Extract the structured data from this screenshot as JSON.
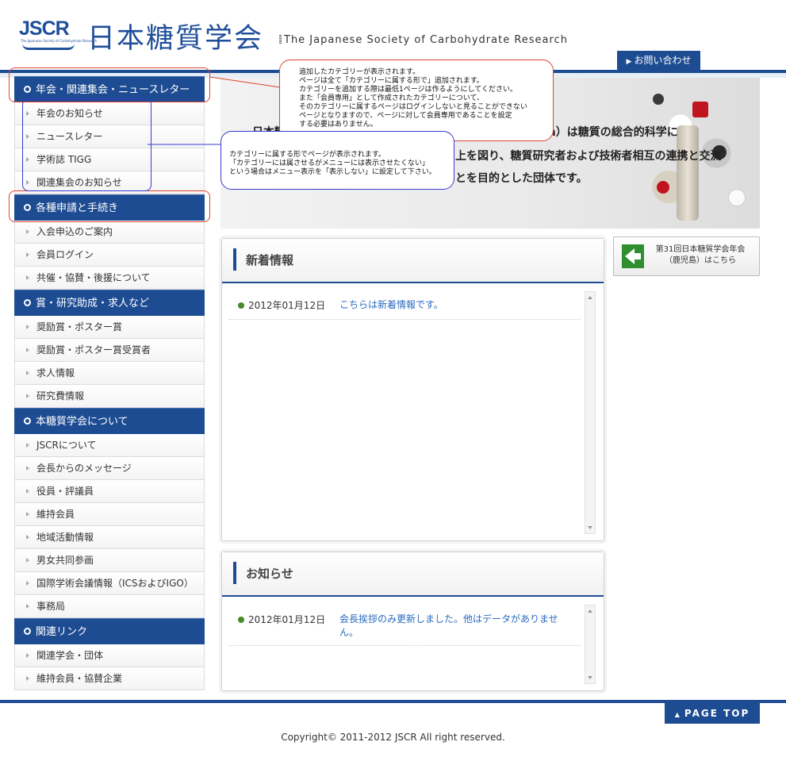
{
  "header": {
    "logo_text": "JSCR",
    "logo_subtext": "The Japanese Society of Carbohydrate Research",
    "title_jp": "日本糖質学会",
    "title_en": "The Japanese Society of Carbohydrate Research",
    "contact_label": "お問い合わせ"
  },
  "sidebar": {
    "groups": [
      {
        "title": "年会・関連集会・ニュースレター",
        "items": [
          "年会のお知らせ",
          "ニュースレター",
          "学術誌 TIGG",
          "関連集会のお知らせ"
        ]
      },
      {
        "title": "各種申請と手続き",
        "items": [
          "入会申込のご案内",
          "会員ログイン",
          "共催・協賛・後援について"
        ]
      },
      {
        "title": "賞・研究助成・求人など",
        "items": [
          "奨励賞・ポスター賞",
          "奨励賞・ポスター賞受賞者",
          "求人情報",
          "研究費情報"
        ]
      },
      {
        "title": "本糖質学会について",
        "items": [
          "JSCRについて",
          "会長からのメッセージ",
          "役員・評議員",
          "維持会員",
          "地域活動情報",
          "男女共同参画",
          "国際学術会議情報（ICSおよびIGO）",
          "事務局"
        ]
      },
      {
        "title": "関連リンク",
        "items": [
          "関連学会・団体",
          "維持会員・協賛企業"
        ]
      }
    ]
  },
  "main_visual": {
    "line1_start": "日本糖",
    "line1_end": "Research）は糖質の総合的科学に",
    "line2": "上を図り、糖質研究者および技術者相互の連携と交流",
    "line3": "とを目的とした団体です。"
  },
  "news": {
    "title": "新着情報",
    "items": [
      {
        "date": "2012年01月12日",
        "title": "こちらは新着情報です。"
      }
    ]
  },
  "notices": {
    "title": "お知らせ",
    "items": [
      {
        "date": "2012年01月12日",
        "title": "会長挨拶のみ更新しました。他はデータがありません。"
      }
    ]
  },
  "banner": {
    "line1": "第31回日本糖質学会年会",
    "line2": "（鹿児島）はこちら"
  },
  "annotations": {
    "callout1": [
      "追加したカテゴリーが表示されます。",
      "ページは全て「カテゴリーに属する形で」追加されます。",
      "カテゴリーを追加する際は最低1ページは作るようにしてください。",
      "また「会員専用」として作成されたカテゴリーについて、",
      "そのカテゴリーに属するページはログインしないと見ることができない",
      "ページとなりますので、ページに対して会員専用であることを設定",
      "する必要はありません。"
    ],
    "callout2": [
      "カテゴリーに属する形でページが表示されます。",
      "「カテゴリーには属させるがメニューには表示させたくない」",
      "という場合はメニュー表示を「表示しない」に設定して下さい。"
    ]
  },
  "footer": {
    "page_top_label": "PAGE TOP",
    "copyright": "Copyright© 2011-2012 JSCR All right reserved."
  },
  "colors": {
    "brand_blue": "#1e4c92",
    "link_blue": "#2a6bc1",
    "annotation_red": "#dd4433",
    "annotation_blue": "#3a3ad0"
  }
}
